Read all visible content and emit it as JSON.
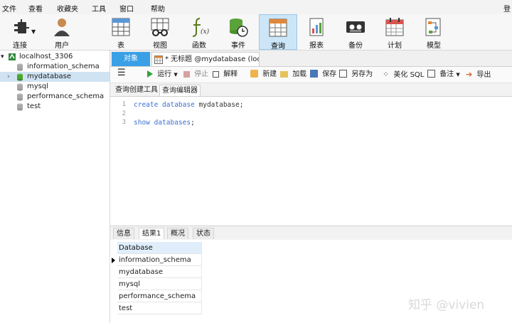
{
  "menu": {
    "items": [
      "文件",
      "查看",
      "收藏夹",
      "工具",
      "窗口",
      "帮助"
    ],
    "right_cut": "登"
  },
  "ribbon": {
    "buttons": [
      {
        "label": "连接",
        "icon": "connection-plug-icon"
      },
      {
        "label": "用户",
        "icon": "user-icon"
      },
      {
        "label": "表",
        "icon": "table-icon"
      },
      {
        "label": "视图",
        "icon": "view-glasses-icon"
      },
      {
        "label": "函数",
        "icon": "function-fx-icon"
      },
      {
        "label": "事件",
        "icon": "event-clock-icon"
      },
      {
        "label": "查询",
        "icon": "query-icon",
        "active": true
      },
      {
        "label": "报表",
        "icon": "report-icon"
      },
      {
        "label": "备份",
        "icon": "backup-tape-icon"
      },
      {
        "label": "计划",
        "icon": "schedule-calendar-icon"
      },
      {
        "label": "模型",
        "icon": "model-icon"
      }
    ]
  },
  "sidebar": {
    "connection": "localhost_3306",
    "databases": [
      "information_schema",
      "mydatabase",
      "mysql",
      "performance_schema",
      "test"
    ],
    "selected": "mydatabase"
  },
  "tabs": {
    "object": "对象",
    "query": "* 无标题 @mydatabase (loc..."
  },
  "toolbar": {
    "run": "运行",
    "stop": "停止",
    "explain": "解释",
    "new": "新建",
    "load": "加载",
    "save": "保存",
    "save_as": "另存为",
    "beautify": "美化 SQL",
    "comment": "备注",
    "export": "导出"
  },
  "subtabs": {
    "builder": "查询创建工具",
    "editor": "查询编辑器"
  },
  "editor": {
    "lines": [
      {
        "num": "1",
        "kw": "create database",
        "rest": " mydatabase;"
      },
      {
        "num": "2",
        "kw": "",
        "rest": ""
      },
      {
        "num": "3",
        "kw": "show databases",
        "rest": ";"
      }
    ]
  },
  "result_tabs": [
    "信息",
    "结果1",
    "概况",
    "状态"
  ],
  "result": {
    "header": "Database",
    "rows": [
      "information_schema",
      "mydatabase",
      "mysql",
      "performance_schema",
      "test"
    ]
  },
  "watermark": "知乎 @vivien",
  "colors": {
    "accent": "#3aa0e6",
    "keyword": "#3b6fd1",
    "selection": "#cfe3f3"
  }
}
